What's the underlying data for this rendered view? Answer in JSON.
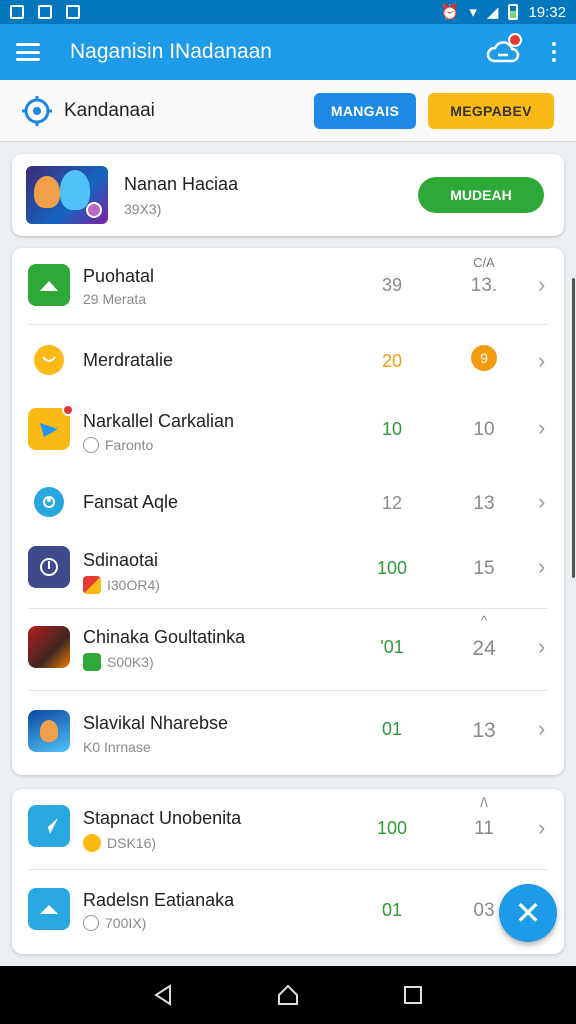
{
  "status_bar": {
    "time": "19:32"
  },
  "appbar": {
    "title": "Naganisin INadanaan",
    "menu_icon": "hamburger-icon",
    "sync_icon": "cloud-sync-icon",
    "more_icon": "more-vert-icon"
  },
  "toolbar": {
    "label": "Kandanaai",
    "btn_primary": "MANGAIS",
    "btn_secondary": "MEGPABEV",
    "accent_blue": "#1e88e5",
    "accent_yellow": "#fbb915"
  },
  "featured": {
    "name": "Nanan Haciaa",
    "sub": "39X3)",
    "action": "MUDEAH",
    "accent_green": "#2ea836"
  },
  "list1": [
    {
      "title": "Puohatal",
      "sub": "29 Merata",
      "val1": "39",
      "val2": "13.",
      "hint": "C/A",
      "icon": "home-icon"
    },
    {
      "title": "Merdratalie",
      "sub": "",
      "val1": "20",
      "val2": "9",
      "icon": "coin-icon"
    },
    {
      "title": "Narkallel Carkalian",
      "sub": "Faronto",
      "val1": "10",
      "val2": "10",
      "icon": "media-icon"
    },
    {
      "title": "Fansat Aqle",
      "sub": "",
      "val1": "12",
      "val2": "13",
      "icon": "gear-icon"
    },
    {
      "title": "Sdinaotai",
      "sub": "I30OR4)",
      "val1": "100",
      "val2": "15",
      "icon": "power-icon"
    },
    {
      "title": "Chinaka Goultatinka",
      "sub": "S00K3)",
      "val1": "'01",
      "val2": "24",
      "hint": "^",
      "icon": "game-icon"
    },
    {
      "title": "Slavikal Nharebse",
      "sub": "K0 Inrnase",
      "val1": "01",
      "val2": "13",
      "icon": "avatar-icon"
    }
  ],
  "list2": [
    {
      "title": "Stapnact Unobenita",
      "sub": "DSK16)",
      "val1": "100",
      "val2": "11",
      "hint": "/\\",
      "icon": "send-icon"
    },
    {
      "title": "Radelsn Eatianaka",
      "sub": "700IX)",
      "val1": "01",
      "val2": "03",
      "icon": "cloud-icon"
    }
  ],
  "fab": {
    "icon": "close-icon",
    "glyph": "✕"
  },
  "nav": {
    "back": "back-icon",
    "home": "home-nav-icon",
    "recents": "recents-icon"
  }
}
